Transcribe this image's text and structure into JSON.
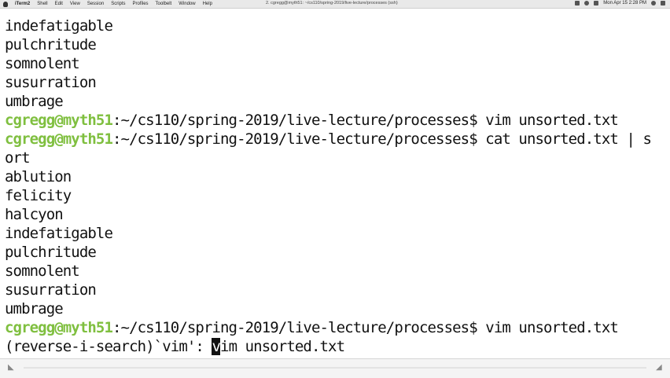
{
  "menubar": {
    "app_name": "iTerm2",
    "items": [
      "Shell",
      "Edit",
      "View",
      "Session",
      "Scripts",
      "Profiles",
      "Toolbelt",
      "Window",
      "Help"
    ],
    "window_title": "2. cgregg@myth51: ~/cs110/spring-2019/live-lecture/processes (ssh)",
    "clock": "Mon Apr 15  2:28 PM"
  },
  "terminal": {
    "lines": [
      {
        "text": "indefatigable"
      },
      {
        "text": "pulchritude"
      },
      {
        "text": "somnolent"
      },
      {
        "text": "susurration"
      },
      {
        "text": "umbrage"
      },
      {
        "user": "cgregg@myth51",
        "path": ":~/cs110/spring-2019/live-lecture/processes$ ",
        "cmd": "vim unsorted.txt"
      },
      {
        "user": "cgregg@myth51",
        "path": ":~/cs110/spring-2019/live-lecture/processes$ ",
        "cmd": "cat unsorted.txt | s"
      },
      {
        "text": "ort"
      },
      {
        "text": "ablution"
      },
      {
        "text": "felicity"
      },
      {
        "text": "halcyon"
      },
      {
        "text": "indefatigable"
      },
      {
        "text": "pulchritude"
      },
      {
        "text": "somnolent"
      },
      {
        "text": "susurration"
      },
      {
        "text": "umbrage"
      },
      {
        "user": "cgregg@myth51",
        "path": ":~/cs110/spring-2019/live-lecture/processes$ ",
        "cmd": "vim unsorted.txt"
      }
    ],
    "search_line": {
      "prefix": "(reverse-i-search)`vim': ",
      "cursor_char": "v",
      "rest": "im unsorted.txt"
    }
  }
}
